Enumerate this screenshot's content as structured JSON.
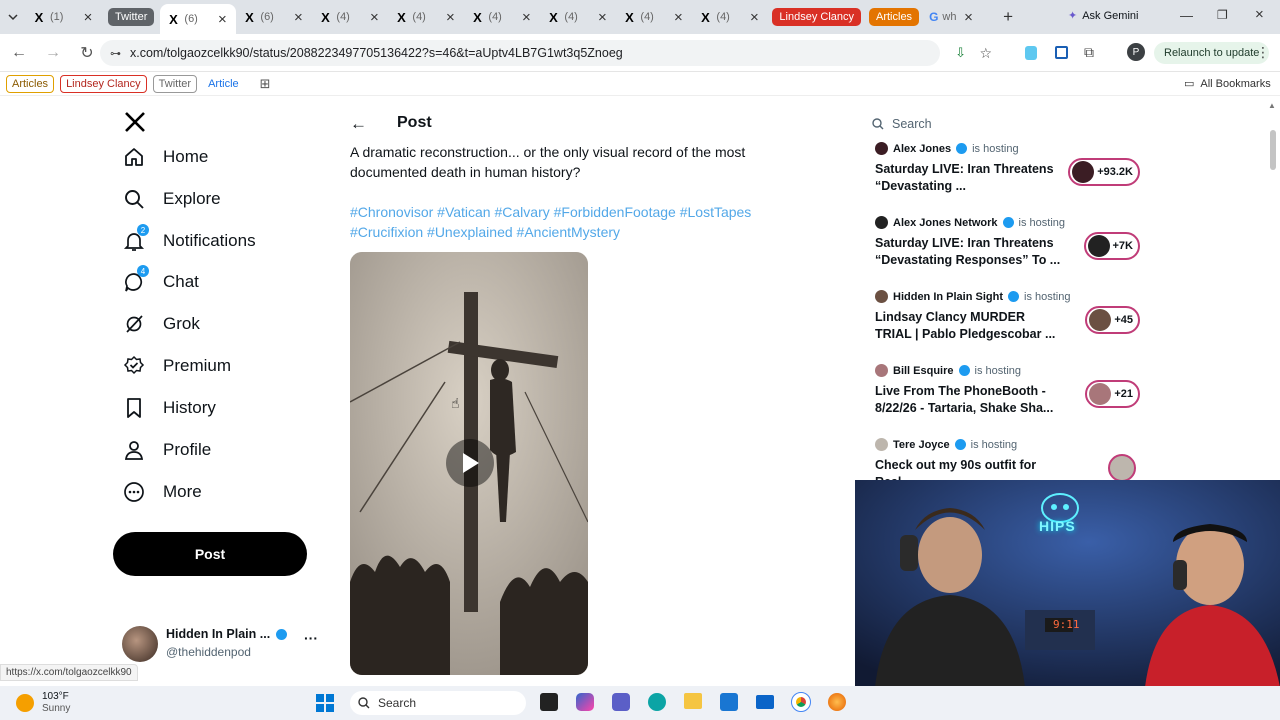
{
  "browser": {
    "tabs": [
      {
        "title": "(1) ",
        "kind": "x"
      },
      {
        "title": "Twitter",
        "kind": "group"
      },
      {
        "title": "(6) ",
        "kind": "x",
        "active": true
      },
      {
        "title": "(6) ",
        "kind": "x"
      },
      {
        "title": "(4) ",
        "kind": "x"
      },
      {
        "title": "(4) ",
        "kind": "x"
      },
      {
        "title": "(4) ",
        "kind": "x"
      },
      {
        "title": "(4) ",
        "kind": "x"
      },
      {
        "title": "(4) ",
        "kind": "x"
      },
      {
        "title": "(4) ",
        "kind": "x"
      }
    ],
    "group_labels": [
      {
        "label": "Lindsey Clancy",
        "color": "#d93025"
      },
      {
        "label": "Articles",
        "color": "#e37400"
      }
    ],
    "google_tab": "wh",
    "ask_gemini": "Ask Gemini",
    "url": "x.com/tolgaozcelkk90/status/2088223497705136422?s=46&t=aUptv4LB7G1wt3q5Znoeg",
    "relaunch": "Relaunch to update",
    "profile_initial": "P",
    "bookmarks": [
      "Articles",
      "Lindsey Clancy",
      "Twitter",
      "Article"
    ],
    "all_bookmarks": "All Bookmarks",
    "status_url": "https://x.com/tolgaozcelkk90"
  },
  "nav": {
    "items": [
      {
        "label": "Home",
        "icon": "home-icon"
      },
      {
        "label": "Explore",
        "icon": "search-icon"
      },
      {
        "label": "Notifications",
        "icon": "bell-icon",
        "badge": "2"
      },
      {
        "label": "Chat",
        "icon": "chat-icon",
        "badge": "4"
      },
      {
        "label": "Grok",
        "icon": "grok-icon"
      },
      {
        "label": "Premium",
        "icon": "premium-icon"
      },
      {
        "label": "History",
        "icon": "bookmark-icon"
      },
      {
        "label": "Profile",
        "icon": "profile-icon"
      },
      {
        "label": "More",
        "icon": "more-icon"
      }
    ],
    "post_button": "Post",
    "account": {
      "name": "Hidden In Plain ...",
      "handle": "@thehiddenpod"
    }
  },
  "post": {
    "header": "Post",
    "text": "A dramatic reconstruction... or the only visual record of the most documented death in human history?",
    "hashtags_line1": "#Chronovisor #Vatican #Calvary #ForbiddenFootage #LostTapes",
    "hashtags_line2": "#Crucifixion #Unexplained #AncientMystery"
  },
  "sidebar": {
    "search_placeholder": "Search",
    "spaces": [
      {
        "host": "Alex Jones",
        "status": "is hosting",
        "title": "Saturday LIVE: Iran Threatens “Devastating ...",
        "count": "+93.2K"
      },
      {
        "host": "Alex Jones Network",
        "status": "is hosting",
        "title": "Saturday LIVE: Iran Threatens “Devastating Responses” To ...",
        "count": "+7K"
      },
      {
        "host": "Hidden In Plain Sight",
        "status": "is hosting",
        "title": "Lindsay Clancy MURDER TRIAL | Pablo Pledgescobar ...",
        "count": "+45"
      },
      {
        "host": "Bill Esquire",
        "status": "is hosting",
        "title": "Live From The PhoneBooth - 8/22/26 - Tartaria, Shake Sha...",
        "count": "+21"
      },
      {
        "host": "Tere Joyce",
        "status": "is hosting",
        "title": "Check out my 90s outfit for Real",
        "count": ""
      }
    ]
  },
  "webcam": {
    "sign": "HIPS",
    "clock": "9:11"
  },
  "taskbar": {
    "weather_temp": "103°F",
    "weather_desc": "Sunny",
    "search": "Search"
  }
}
